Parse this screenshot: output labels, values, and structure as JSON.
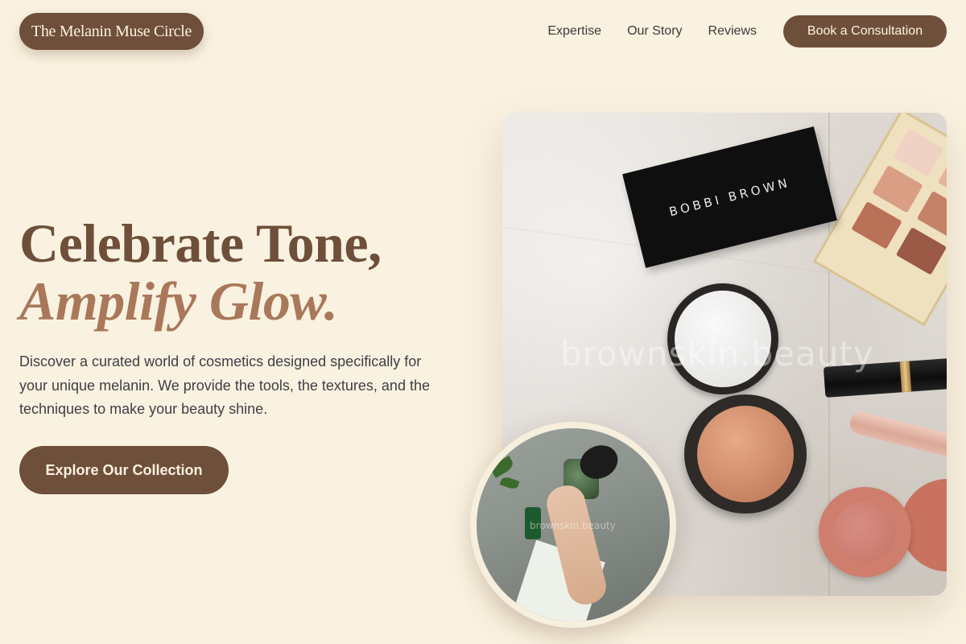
{
  "header": {
    "logo_text": "The Melanin Muse Circle",
    "nav": [
      {
        "label": "Expertise"
      },
      {
        "label": "Our Story"
      },
      {
        "label": "Reviews"
      }
    ],
    "cta_label": "Book a Consultation"
  },
  "hero": {
    "title_line1": "Celebrate Tone,",
    "title_line2": "Amplify Glow.",
    "description": "Discover a curated world of cosmetics designed specifically for your unique melanin. We provide the tools, the textures, and the techniques to make your beauty shine.",
    "cta_label": "Explore Our Collection",
    "image": {
      "brand_text": "BOBBI BROWN",
      "watermark": "brownskin.beauty"
    },
    "inset_image": {
      "watermark": "brownskin.beauty"
    }
  },
  "colors": {
    "background": "#faf2e0",
    "primary_brown": "#6e4f3a",
    "accent_tan": "#a9785a",
    "button_text": "#fbf1e0",
    "body_text": "#3d3f45"
  },
  "icons": []
}
